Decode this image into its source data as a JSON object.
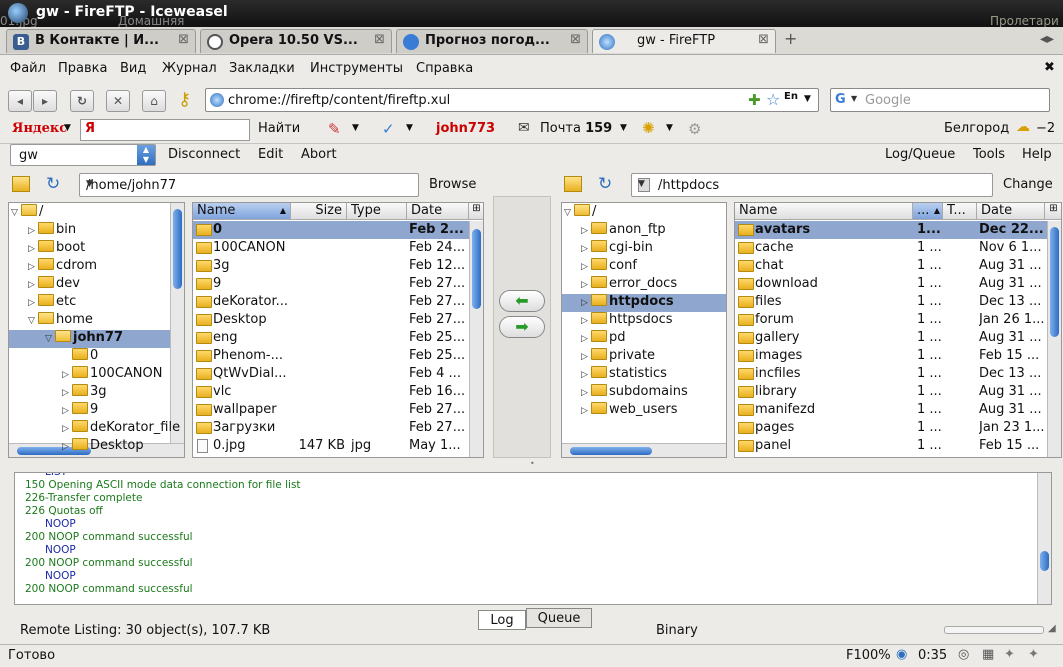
{
  "window": {
    "title": "gw - FireFTP - Iceweasel",
    "bg_text_left": "01.jpg",
    "bg_text_mid": "Домашняя",
    "bg_text_right": "Пролетари"
  },
  "tabs": [
    {
      "label": "В Контакте | И...",
      "icon": "vk-icon",
      "color": "#3b5d8f"
    },
    {
      "label": "Opera 10.50 VS...",
      "icon": "opera-icon",
      "color": "#555"
    },
    {
      "label": "Прогноз погод...",
      "icon": "weather-icon",
      "color": "#3a7bd5"
    },
    {
      "label": "gw - FireFTP",
      "icon": "fireftp-icon",
      "color": "#2f6fc0"
    }
  ],
  "menu": [
    "Файл",
    "Правка",
    "Вид",
    "Журнал",
    "Закладки",
    "Инструменты",
    "Справка"
  ],
  "nav": {
    "url": "chrome://fireftp/content/fireftp.xul",
    "search_placeholder": "Google",
    "lang_badge": "En"
  },
  "yandex": {
    "logo": "Яндекс",
    "search_letter": "Я",
    "find_label": "Найти",
    "user": "john773",
    "mail_label": "Почта",
    "mail_count": "159",
    "city": "Белгород",
    "temperature": "−2"
  },
  "ftp": {
    "host": "gw",
    "disconnect": "Disconnect",
    "edit": "Edit",
    "abort": "Abort",
    "logqueue": "Log/Queue",
    "tools": "Tools",
    "help": "Help"
  },
  "local": {
    "path": "/home/john77",
    "browse": "Browse",
    "tree": [
      {
        "label": "/",
        "indent": 0,
        "arrow": "▽",
        "open": true
      },
      {
        "label": "bin",
        "indent": 1,
        "arrow": "▷"
      },
      {
        "label": "boot",
        "indent": 1,
        "arrow": "▷"
      },
      {
        "label": "cdrom",
        "indent": 1,
        "arrow": "▷"
      },
      {
        "label": "dev",
        "indent": 1,
        "arrow": "▷"
      },
      {
        "label": "etc",
        "indent": 1,
        "arrow": "▷"
      },
      {
        "label": "home",
        "indent": 1,
        "arrow": "▽",
        "open": true
      },
      {
        "label": "john77",
        "indent": 2,
        "arrow": "▽",
        "open": true,
        "selected": true
      },
      {
        "label": "0",
        "indent": 3,
        "arrow": ""
      },
      {
        "label": "100CANON",
        "indent": 3,
        "arrow": "▷"
      },
      {
        "label": "3g",
        "indent": 3,
        "arrow": "▷"
      },
      {
        "label": "9",
        "indent": 3,
        "arrow": "▷"
      },
      {
        "label": "deKorator_file",
        "indent": 3,
        "arrow": "▷"
      },
      {
        "label": "Desktop",
        "indent": 3,
        "arrow": "▷"
      }
    ],
    "columns": [
      "Name",
      "Size",
      "Type",
      "Date"
    ],
    "files": [
      {
        "name": "0",
        "size": "",
        "type": "",
        "date": "Feb 2...",
        "selected": true
      },
      {
        "name": "100CANON",
        "size": "",
        "type": "",
        "date": "Feb 24..."
      },
      {
        "name": "3g",
        "size": "",
        "type": "",
        "date": "Feb 12..."
      },
      {
        "name": "9",
        "size": "",
        "type": "",
        "date": "Feb 27..."
      },
      {
        "name": "deKorator...",
        "size": "",
        "type": "",
        "date": "Feb 27..."
      },
      {
        "name": "Desktop",
        "size": "",
        "type": "",
        "date": "Feb 27..."
      },
      {
        "name": "eng",
        "size": "",
        "type": "",
        "date": "Feb 25..."
      },
      {
        "name": "Phenom-...",
        "size": "",
        "type": "",
        "date": "Feb 25..."
      },
      {
        "name": "QtWvDial...",
        "size": "",
        "type": "",
        "date": "Feb 4 ..."
      },
      {
        "name": "vlc",
        "size": "",
        "type": "",
        "date": "Feb 16..."
      },
      {
        "name": "wallpaper",
        "size": "",
        "type": "",
        "date": "Feb 27..."
      },
      {
        "name": "Загрузки",
        "size": "",
        "type": "",
        "date": "Feb 27..."
      },
      {
        "name": "0.jpg",
        "size": "147 KB",
        "type": "jpg",
        "date": "May 1...",
        "file": true
      }
    ]
  },
  "remote": {
    "path": "/httpdocs",
    "change": "Change",
    "tree": [
      {
        "label": "/",
        "indent": 0,
        "arrow": "▽",
        "open": true
      },
      {
        "label": "anon_ftp",
        "indent": 1,
        "arrow": "▷"
      },
      {
        "label": "cgi-bin",
        "indent": 1,
        "arrow": "▷"
      },
      {
        "label": "conf",
        "indent": 1,
        "arrow": "▷"
      },
      {
        "label": "error_docs",
        "indent": 1,
        "arrow": "▷"
      },
      {
        "label": "httpdocs",
        "indent": 1,
        "arrow": "▷",
        "selected": true
      },
      {
        "label": "httpsdocs",
        "indent": 1,
        "arrow": "▷"
      },
      {
        "label": "pd",
        "indent": 1,
        "arrow": "▷"
      },
      {
        "label": "private",
        "indent": 1,
        "arrow": "▷"
      },
      {
        "label": "statistics",
        "indent": 1,
        "arrow": "▷"
      },
      {
        "label": "subdomains",
        "indent": 1,
        "arrow": "▷"
      },
      {
        "label": "web_users",
        "indent": 1,
        "arrow": "▷"
      }
    ],
    "columns": [
      "Name",
      "...",
      "T...",
      "Date"
    ],
    "files": [
      {
        "name": "avatars",
        "c2": "1...",
        "date": "Dec 22...",
        "selected": true
      },
      {
        "name": "cache",
        "c2": "1 ...",
        "date": "Nov 6 1..."
      },
      {
        "name": "chat",
        "c2": "1 ...",
        "date": "Aug 31 ..."
      },
      {
        "name": "download",
        "c2": "1 ...",
        "date": "Aug 31 ..."
      },
      {
        "name": "files",
        "c2": "1 ...",
        "date": "Dec 13 ..."
      },
      {
        "name": "forum",
        "c2": "1 ...",
        "date": "Jan 26 1..."
      },
      {
        "name": "gallery",
        "c2": "1 ...",
        "date": "Aug 31 ..."
      },
      {
        "name": "images",
        "c2": "1 ...",
        "date": "Feb 15 ..."
      },
      {
        "name": "incfiles",
        "c2": "1 ...",
        "date": "Dec 13 ..."
      },
      {
        "name": "library",
        "c2": "1 ...",
        "date": "Aug 31 ..."
      },
      {
        "name": "manifezd",
        "c2": "1 ...",
        "date": "Aug 31 ..."
      },
      {
        "name": "pages",
        "c2": "1 ...",
        "date": "Jan 23 1..."
      },
      {
        "name": "panel",
        "c2": "1 ...",
        "date": "Feb 15 ..."
      }
    ]
  },
  "log": [
    {
      "text": "LIST",
      "kind": "cmd"
    },
    {
      "text": "150 Opening ASCII mode data connection for file list",
      "kind": "resp"
    },
    {
      "text": "226-Transfer complete",
      "kind": "resp"
    },
    {
      "text": "226 Quotas off",
      "kind": "resp"
    },
    {
      "text": "NOOP",
      "kind": "cmd"
    },
    {
      "text": "200 NOOP command successful",
      "kind": "resp"
    },
    {
      "text": "NOOP",
      "kind": "cmd"
    },
    {
      "text": "200 NOOP command successful",
      "kind": "resp"
    },
    {
      "text": "NOOP",
      "kind": "cmd"
    },
    {
      "text": "200 NOOP command successful",
      "kind": "resp"
    }
  ],
  "logtabs": {
    "log": "Log",
    "queue": "Queue"
  },
  "status": {
    "remote_listing": "Remote Listing: 30 object(s), 107.7 KB",
    "mode": "Binary",
    "ready": "Готово",
    "zoom": "F100%",
    "time": "0:35"
  }
}
